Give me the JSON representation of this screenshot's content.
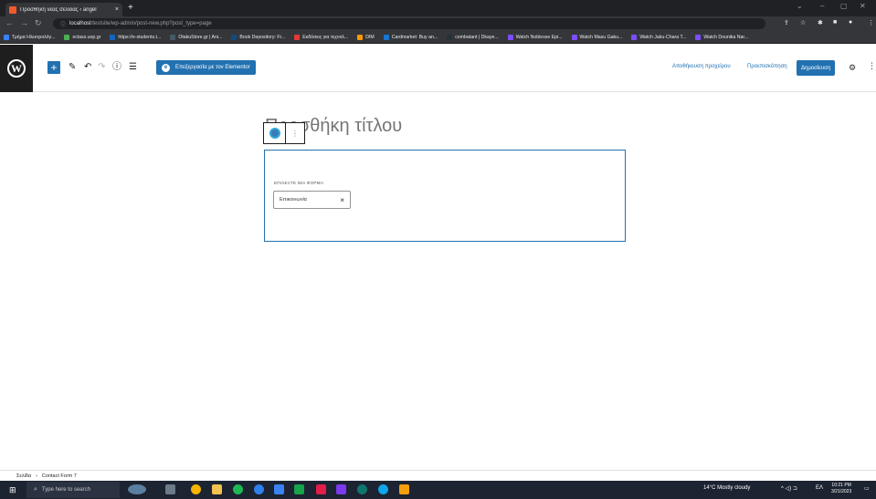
{
  "browser": {
    "tab_title": "Προσθήκη νέας σελίδας ‹ angel",
    "tab_close": "×",
    "new_tab": "+",
    "url_host": "localhost",
    "url_path": "/testsite/wp-admin/post-new.php?post_type=page",
    "window_controls": [
      "⌄",
      "–",
      "▢",
      "✕"
    ],
    "bookmarks": [
      {
        "label": "Τμήμα Ηλεκτρολόγ...",
        "color": "#3b82f6"
      },
      {
        "label": "eclass.uop.gr",
        "color": "#4caf50"
      },
      {
        "label": "https://e-students.t...",
        "color": "#1565c0"
      },
      {
        "label": "OtakuStore.gr | Ani...",
        "color": "#455a64"
      },
      {
        "label": "Book Depository: Fr...",
        "color": "#0f4c81"
      },
      {
        "label": "Εκδόσεις για τεχνολ...",
        "color": "#e53935"
      },
      {
        "label": "DIM",
        "color": "#ff9800"
      },
      {
        "label": "Cardmarket: Buy an...",
        "color": "#1976d2"
      },
      {
        "label": "combatant | Dkaye...",
        "color": "#263238"
      },
      {
        "label": "Watch Noblesse Epi...",
        "color": "#7c4dff"
      },
      {
        "label": "Watch Masu Gaku...",
        "color": "#7c4dff"
      },
      {
        "label": "Watch Jaku-Chara T...",
        "color": "#7c4dff"
      },
      {
        "label": "Watch Dounika Nar...",
        "color": "#7c4dff"
      }
    ]
  },
  "wp": {
    "elementor_label": "Επεξεργασία με τον Elementor",
    "save_draft": "Αποθήκευση προχείρου",
    "preview": "Προεπισκόπηση",
    "publish": "Δημοσίευση",
    "title_placeholder": "Προσθήκη τίτλου",
    "cf7": {
      "label": "ΕΠΙΛΕΞΤΕ ΜΙΑ ΦΟΡΜΑ:",
      "selected": "Επικοινωνία",
      "clear": "×"
    },
    "breadcrumb": [
      "Σελίδα",
      "Contact Form 7"
    ],
    "breadcrumb_sep": "›"
  },
  "taskbar": {
    "search_placeholder": "Type here to search",
    "weather": "14°C  Mostly cloudy",
    "language": "ΕΛ",
    "time": "10:21 PM",
    "date": "3/21/2023"
  }
}
